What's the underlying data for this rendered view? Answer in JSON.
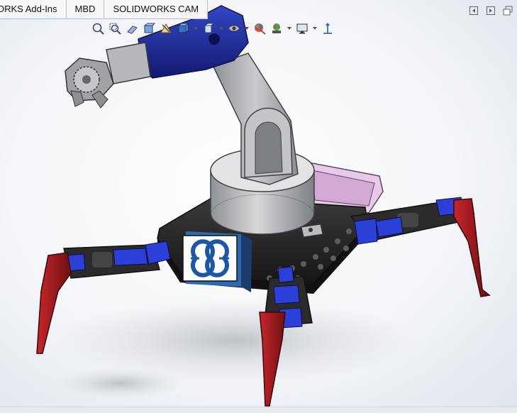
{
  "tabs": [
    {
      "label": "ORKS Add-Ins"
    },
    {
      "label": "MBD"
    },
    {
      "label": "SOLIDWORKS CAM"
    }
  ],
  "viewbar_icons": [
    "zoom-to-fit-icon",
    "zoom-to-area-icon",
    "previous-view-icon",
    "section-view-icon",
    "dynamic-annotation-icon",
    "view-orientation-icon",
    "display-style-icon",
    "hide-show-items-icon",
    "edit-appearance-icon",
    "apply-scene-icon",
    "view-settings-icon",
    "triad-icon"
  ],
  "window_controls": [
    "tile-left-icon",
    "tile-right-icon",
    "restore-window-icon"
  ],
  "colors": {
    "arm_blue": "#1f2f9e",
    "arm_grey": "#a9acb0",
    "plate_black": "#222222",
    "leg_red": "#a01c20",
    "servo_blue": "#2c3fd6",
    "tray_pink": "#e8c9e8",
    "arduino_blue": "#1a57a8"
  }
}
